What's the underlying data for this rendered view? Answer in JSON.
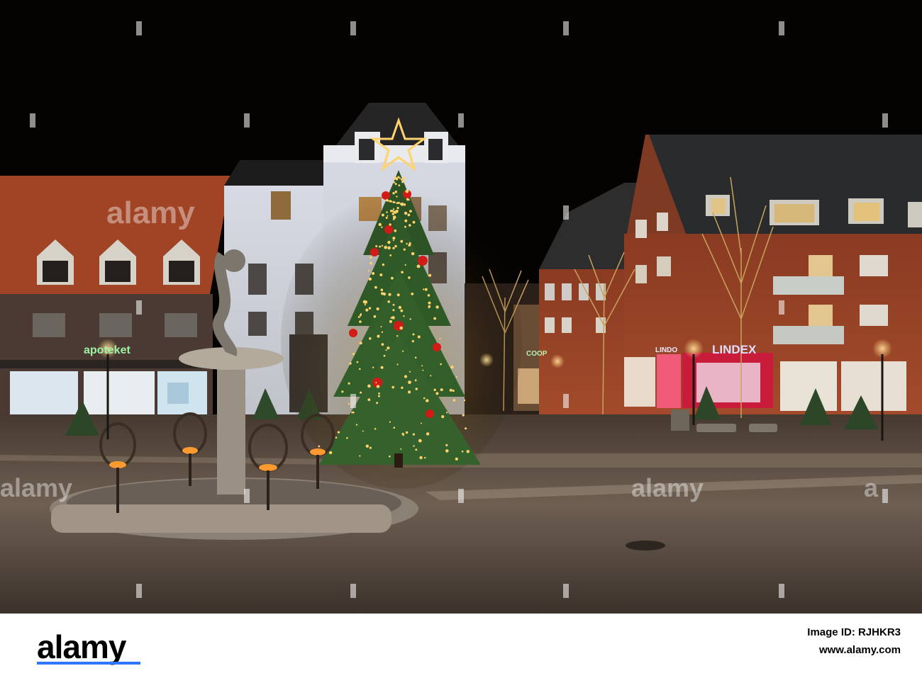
{
  "watermarks": {
    "main": "alamy",
    "side_left": "alamy",
    "side_center": "alamy",
    "side_right": "a"
  },
  "signs": {
    "pharmacy": "apoteket",
    "grocery": "COOP",
    "fashion": "LINDEX",
    "small": "LINDO"
  },
  "footer": {
    "brand": "alamy",
    "image_id": "Image ID: RJHKR3",
    "url": "www.alamy.com"
  },
  "colors": {
    "sky": "#050302",
    "tree_lights": "#ffd36b",
    "ornament_red": "#d21b16",
    "plaza_stone": "#8a7967",
    "footer_bg": "#ffffff",
    "brand_text": "#000000"
  },
  "icons": {
    "watermark_mark": "alamy-wordmark",
    "tree": "christmas-tree-lights",
    "star": "illuminated-star"
  }
}
